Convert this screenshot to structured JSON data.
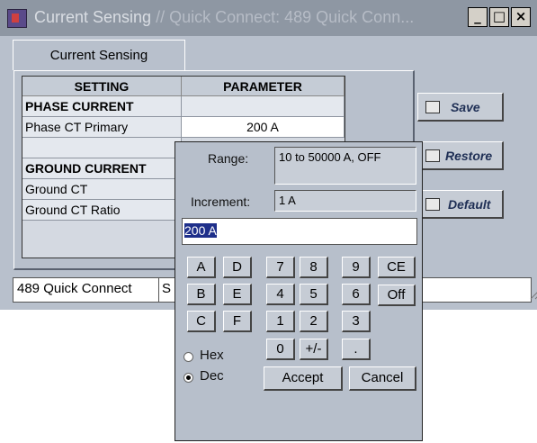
{
  "window": {
    "title_main": "Current Sensing",
    "title_rest": " // Quick Connect: 489 Quick Conn...",
    "controls": [
      "_",
      "□",
      "×"
    ]
  },
  "tab": {
    "label": "Current Sensing"
  },
  "grid": {
    "headers": [
      "SETTING",
      "PARAMETER"
    ],
    "rows": [
      {
        "setting": "PHASE CURRENT",
        "parameter": ""
      },
      {
        "setting": "Phase CT Primary",
        "parameter": "200 A"
      },
      {
        "setting": "",
        "parameter": ""
      },
      {
        "setting": "GROUND CURRENT",
        "parameter": ""
      },
      {
        "setting": "Ground CT",
        "parameter": ""
      },
      {
        "setting": "Ground CT Ratio",
        "parameter": ""
      }
    ]
  },
  "buttons": {
    "save": "Save",
    "restore": "Restore",
    "default": "Default"
  },
  "status": {
    "left": "489 Quick Connect",
    "right": "S"
  },
  "keypad": {
    "range_label": "Range:",
    "range_value": "10 to 50000 A, OFF",
    "increment_label": "Increment:",
    "increment_value": "1 A",
    "entry": "200 A",
    "keys": {
      "a": "A",
      "b": "B",
      "c": "C",
      "d": "D",
      "e": "E",
      "f": "F",
      "n7": "7",
      "n8": "8",
      "n9": "9",
      "n4": "4",
      "n5": "5",
      "n6": "6",
      "n1": "1",
      "n2": "2",
      "n3": "3",
      "n0": "0",
      "sign": "+/-",
      "dot": ".",
      "ce": "CE",
      "off": "Off"
    },
    "hex_label": "Hex",
    "dec_label": "Dec",
    "accept": "Accept",
    "cancel": "Cancel"
  }
}
